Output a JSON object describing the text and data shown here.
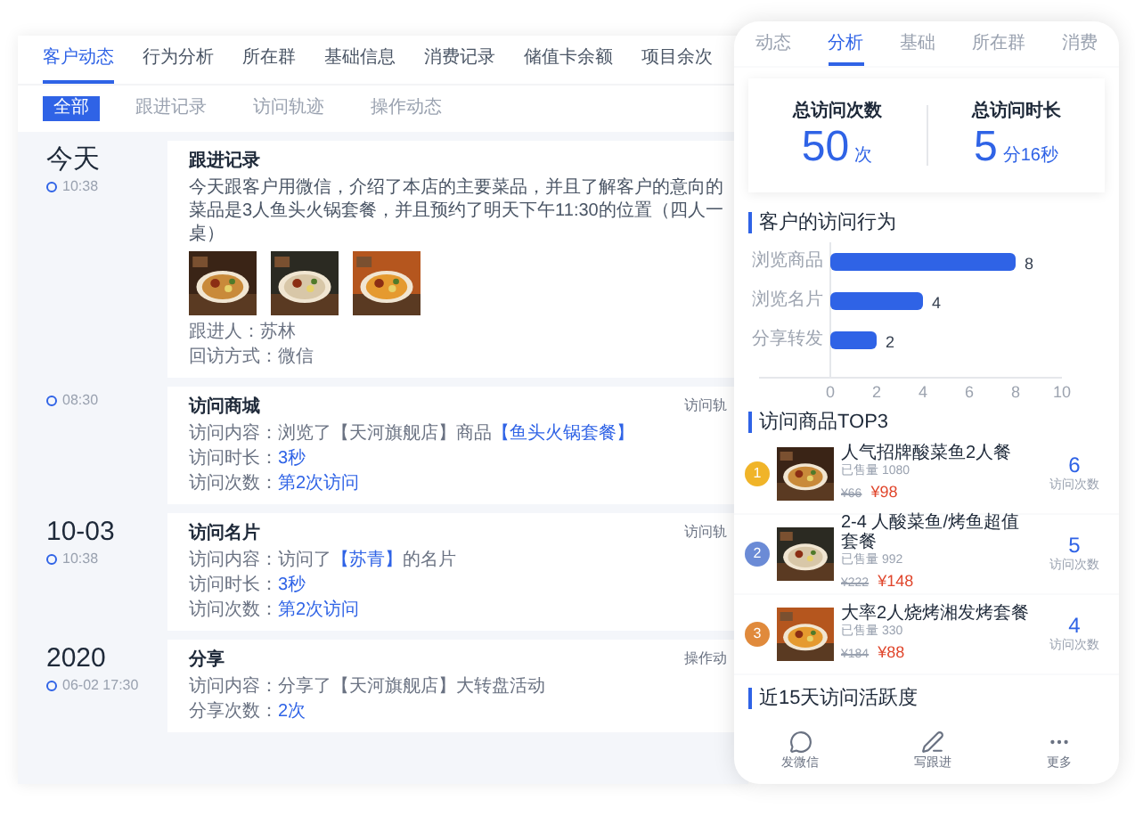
{
  "main_tabs": [
    {
      "label": "客户动态",
      "selected": true
    },
    {
      "label": "行为分析",
      "selected": false
    },
    {
      "label": "所在群",
      "selected": false
    },
    {
      "label": "基础信息",
      "selected": false
    },
    {
      "label": "消费记录",
      "selected": false
    },
    {
      "label": "储值卡余额",
      "selected": false
    },
    {
      "label": "项目余次",
      "selected": false
    }
  ],
  "sub_tabs": [
    {
      "label": "全部",
      "selected": true
    },
    {
      "label": "跟进记录",
      "selected": false
    },
    {
      "label": "访问轨迹",
      "selected": false
    },
    {
      "label": "操作动态",
      "selected": false
    }
  ],
  "timeline": [
    {
      "date": "今天",
      "time": "10:38",
      "card": {
        "title": "跟进记录",
        "text": "今天跟客户用微信，介绍了本店的主要菜品，并且了解客户的意向的菜品是3人鱼头火锅套餐，并且预约了明天下午11:30的位置（四人一桌）",
        "fields": [
          {
            "label": "跟进人：",
            "parts": [
              {
                "text": "苏林",
                "link": false
              }
            ]
          },
          {
            "label": "回访方式：",
            "parts": [
              {
                "text": "微信",
                "link": false
              }
            ]
          }
        ]
      }
    },
    {
      "time": "08:30",
      "card": {
        "title": "访问商城",
        "tag": "访问轨",
        "fields": [
          {
            "label": "访问内容：",
            "parts": [
              {
                "text": "浏览了【天河旗舰店】商品",
                "link": false
              },
              {
                "text": "【鱼头火锅套餐】",
                "link": true
              }
            ]
          },
          {
            "label": "访问时长：",
            "parts": [
              {
                "text": "3秒",
                "link": true
              }
            ]
          },
          {
            "label": "访问次数：",
            "parts": [
              {
                "text": "第2次访问",
                "link": true
              }
            ]
          }
        ]
      }
    },
    {
      "date": "10-03",
      "time": "10:38",
      "card": {
        "title": "访问名片",
        "tag": "访问轨",
        "fields": [
          {
            "label": "访问内容：",
            "parts": [
              {
                "text": "访问了",
                "link": false
              },
              {
                "text": "【苏青】",
                "link": true
              },
              {
                "text": "的名片",
                "link": false
              }
            ]
          },
          {
            "label": "访问时长：",
            "parts": [
              {
                "text": "3秒",
                "link": true
              }
            ]
          },
          {
            "label": "访问次数：",
            "parts": [
              {
                "text": "第2次访问",
                "link": true
              }
            ]
          }
        ]
      }
    },
    {
      "date": "2020",
      "time": "06-02 17:30",
      "card": {
        "title": "分享",
        "tag": "操作动",
        "fields": [
          {
            "label": "访问内容：",
            "parts": [
              {
                "text": "分享了【天河旗舰店】大转盘活动",
                "link": false
              }
            ]
          },
          {
            "label": "分享次数：",
            "parts": [
              {
                "text": "2次",
                "link": true
              }
            ]
          }
        ]
      }
    }
  ],
  "phone": {
    "tabs": [
      {
        "label": "动态",
        "selected": false
      },
      {
        "label": "分析",
        "selected": true
      },
      {
        "label": "基础",
        "selected": false
      },
      {
        "label": "所在群",
        "selected": false
      },
      {
        "label": "消费",
        "selected": false
      }
    ],
    "stats": [
      {
        "label": "总访问次数",
        "value": "50",
        "unit": "次"
      },
      {
        "label": "总访问时长",
        "value": "5",
        "unit": "分16秒"
      }
    ],
    "behavior": {
      "title": "客户的访问行为",
      "chart_data": {
        "type": "bar",
        "orientation": "horizontal",
        "categories": [
          "浏览商品",
          "浏览名片",
          "分享转发"
        ],
        "series": [
          {
            "color": "#2f63e6",
            "values": [
              8,
              4,
              2
            ]
          }
        ],
        "xlim": [
          0,
          10
        ],
        "xticks": [
          0,
          2,
          4,
          6,
          8,
          10
        ],
        "data_labels": true
      }
    },
    "top3": {
      "title": "访问商品TOP3",
      "items": [
        {
          "rank": "1",
          "color": "#f0b429",
          "name": "人气招牌酸菜鱼2人餐",
          "sales": "已售量 1080",
          "old_price": "¥66",
          "price": "¥98",
          "count": "6",
          "count_label": "访问次数"
        },
        {
          "rank": "2",
          "color": "#6b8bd6",
          "name": "2-4 人酸菜鱼/烤鱼超值套餐",
          "sales": "已售量 992",
          "old_price": "¥222",
          "price": "¥148",
          "count": "5",
          "count_label": "访问次数"
        },
        {
          "rank": "3",
          "color": "#e08a3c",
          "name": "大率2人烧烤湘发烤套餐",
          "sales": "已售量 330",
          "old_price": "¥184",
          "price": "¥88",
          "count": "4",
          "count_label": "访问次数"
        }
      ]
    },
    "activity": {
      "title": "近15天访问活跃度"
    },
    "nav": [
      {
        "kind": "chat",
        "label": "发微信"
      },
      {
        "kind": "pen",
        "label": "写跟进"
      },
      {
        "kind": "more",
        "label": "更多"
      }
    ]
  }
}
